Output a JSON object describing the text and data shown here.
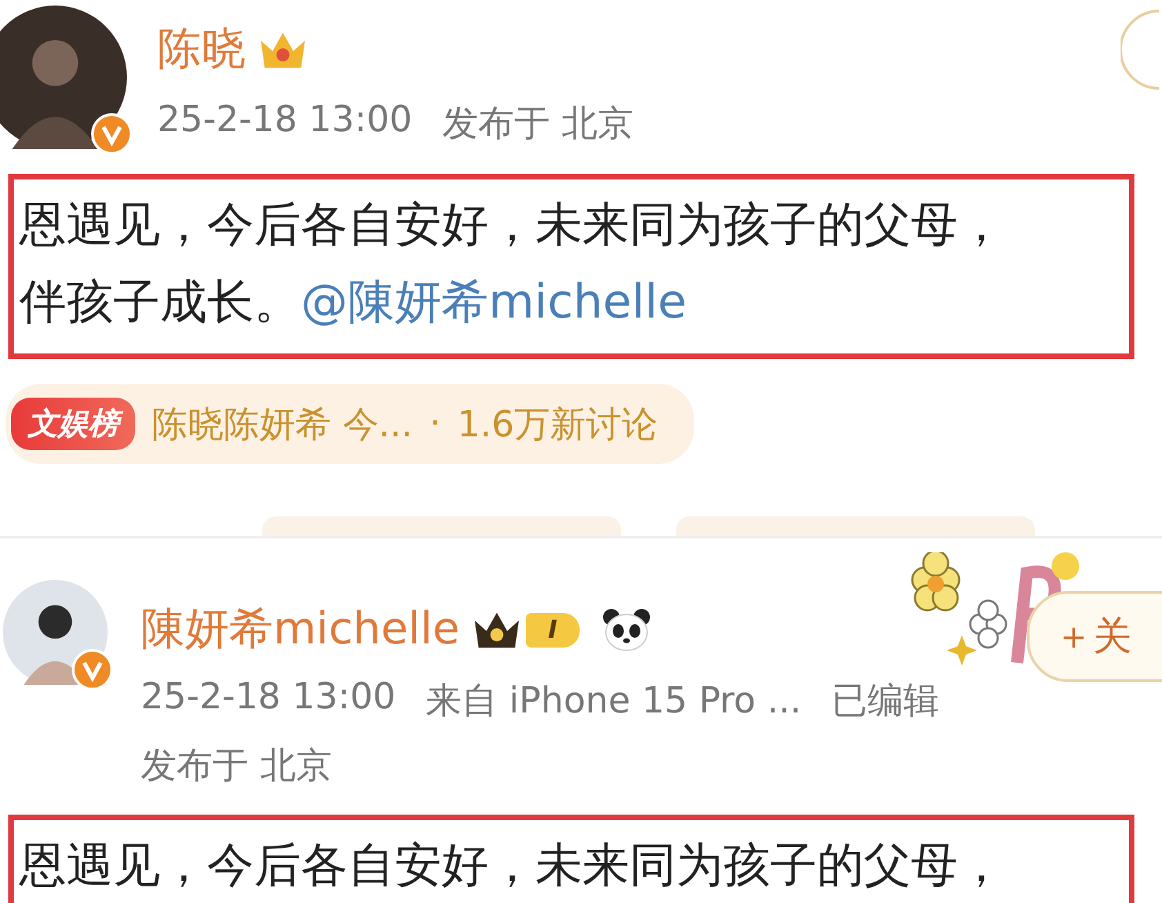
{
  "posts": [
    {
      "author": "陈晓",
      "verified": true,
      "crown": true,
      "meta": [
        "25-2-18 13:00",
        "发布于 北京"
      ],
      "highlighted": true,
      "lines": [
        {
          "text": "恩遇见，今后各自安好，未来同为孩子的父母，"
        },
        {
          "text": "伴孩子成长。",
          "mention": "@陳妍希michelle"
        }
      ],
      "hot_topic": {
        "badge": "文娱榜",
        "title": "陈晓陈妍希 今...",
        "dot": "·",
        "count": "1.6万新讨论"
      }
    },
    {
      "author": "陳妍希michelle",
      "verified": true,
      "crown": true,
      "level_badge": "I",
      "meta": [
        "25-2-18 13:00",
        "来自 iPhone 15 Pro ...",
        "已编辑"
      ],
      "location": "发布于 北京",
      "highlighted": true,
      "lines": [
        {
          "text": "恩遇见，今后各自安好，未来同为孩子的父母，"
        }
      ],
      "follow": "＋关"
    }
  ]
}
